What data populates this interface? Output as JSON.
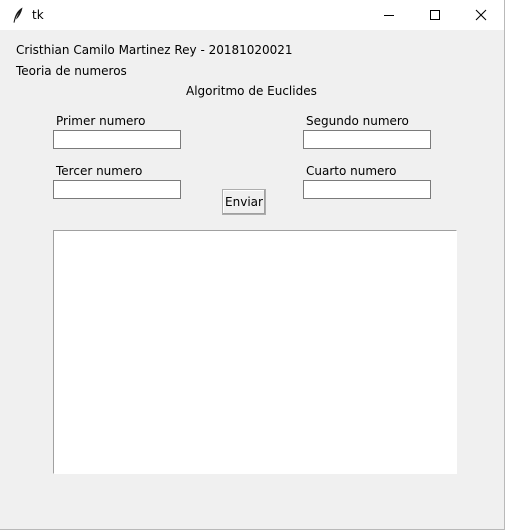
{
  "window": {
    "title": "tk",
    "icon": "feather-icon",
    "controls": {
      "minimize": "minimize-icon",
      "maximize": "maximize-icon",
      "close": "close-icon"
    }
  },
  "header": {
    "author": "Cristhian Camilo Martinez Rey - 20181020021",
    "course": "Teoria de numeros",
    "algorithm": "Algoritmo de Euclides"
  },
  "form": {
    "first_label": "Primer numero",
    "first_value": "",
    "second_label": "Segundo numero",
    "second_value": "",
    "third_label": "Tercer numero",
    "third_value": "",
    "fourth_label": "Cuarto numero",
    "fourth_value": "",
    "submit_label": "Enviar"
  },
  "output": {
    "text": ""
  },
  "colors": {
    "background": "#f0f0f0",
    "titlebar": "#ffffff",
    "field": "#ffffff",
    "border": "#7a7a7a"
  }
}
